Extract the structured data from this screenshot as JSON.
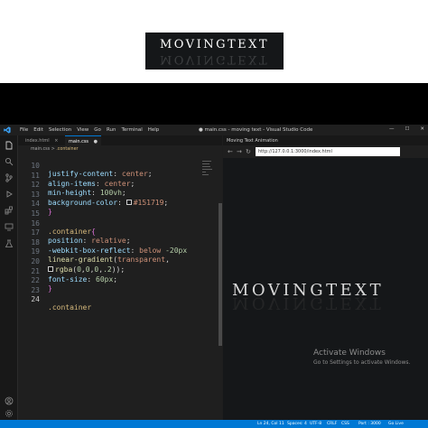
{
  "banner": {
    "text": "MOVINGTEXT"
  },
  "titlebar": {
    "menu": [
      "File",
      "Edit",
      "Selection",
      "View",
      "Go",
      "Run",
      "Terminal",
      "Help"
    ],
    "title": "● main.css - moving text - Visual Studio Code"
  },
  "editor": {
    "tabs": [
      {
        "label": "index.html",
        "close": "×"
      },
      {
        "label": "main.css",
        "close": "●"
      }
    ],
    "breadcrumb": {
      "file": "main.css",
      "sep": ">",
      "selector": ".container"
    },
    "lines": [
      {
        "num": "10",
        "text": "justify-content: center;"
      },
      {
        "num": "11",
        "text": "align-items: center;"
      },
      {
        "num": "12",
        "text": "min-height: 100vh;"
      },
      {
        "num": "13",
        "text": "background-color: #151719;"
      },
      {
        "num": "14",
        "text": "}"
      },
      {
        "num": "15",
        "text": ""
      },
      {
        "num": "16",
        "text": ".container{"
      },
      {
        "num": "17",
        "text": "position: relative;"
      },
      {
        "num": "18",
        "text": "-webkit-box-reflect: below -20px"
      },
      {
        "num": "19",
        "text": "linear-gradient(transparent,"
      },
      {
        "num": "20",
        "text": "rgba(0,0,0,.2));"
      },
      {
        "num": "21",
        "text": "font-size: 60px;"
      },
      {
        "num": "22",
        "text": "}"
      },
      {
        "num": "23",
        "text": ""
      },
      {
        "num": "24",
        "text": ".container"
      }
    ],
    "current_line": "24"
  },
  "browser": {
    "tab_title": "Moving Text Animation",
    "url": "http://127.0.0.1:3000/index.html",
    "heading": "MOVINGTEXT",
    "activate_title": "Activate Windows",
    "activate_sub": "Go to Settings to activate Windows."
  },
  "statusbar": {
    "cursor": "Ln 24, Col 11",
    "spaces": "Spaces: 4",
    "encoding": "UTF-8",
    "eol": "CRLF",
    "language": "CSS",
    "port": "Port : 3000",
    "golive": "Go Live"
  },
  "colors": {
    "background_swatch": "#151719",
    "accent": "#0078d4"
  }
}
